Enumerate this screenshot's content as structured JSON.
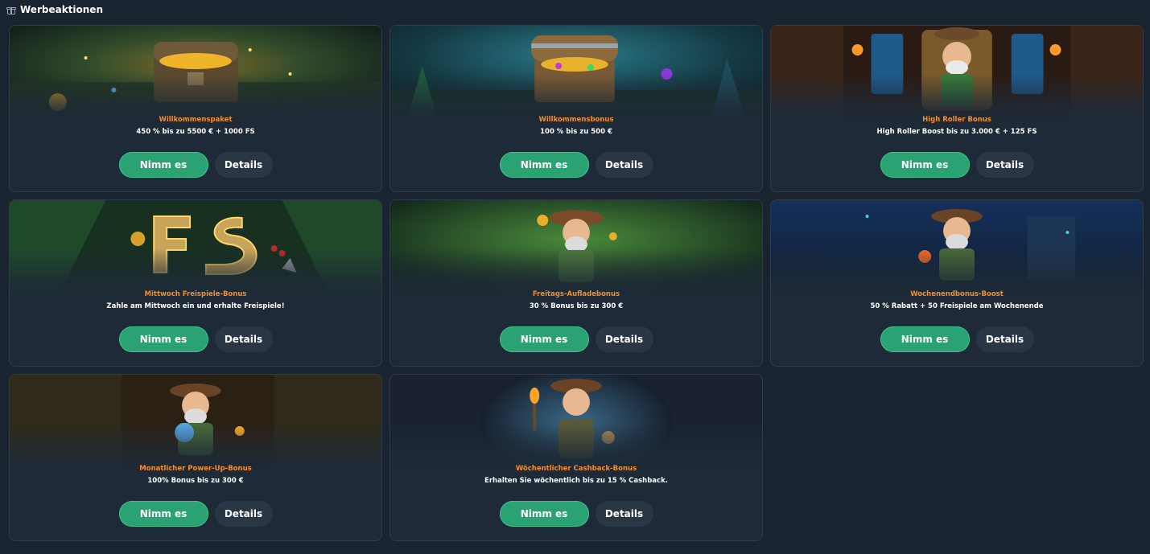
{
  "header": {
    "title": "Werbeaktionen",
    "icon": "gift-icon"
  },
  "colors": {
    "accent_orange": "#f28f2c",
    "take_button": "#2aa273",
    "details_button": "#2a3644",
    "card_bg": "#1e2a37",
    "page_bg": "#1a2430"
  },
  "buttons": {
    "take_label": "Nimm es",
    "details_label": "Details"
  },
  "cards": [
    {
      "title": "Willkommenspaket",
      "desc": "450 % bis zu 5500 € + 1000 FS",
      "art": "treasure-chest"
    },
    {
      "title": "Willkommensbonus",
      "desc": "100 % bis zu 500 €",
      "art": "treasure-chest"
    },
    {
      "title": "High Roller Bonus",
      "desc": "High Roller Boost bis zu 3.000 € + 125 FS",
      "art": "explorer-throne"
    },
    {
      "title": "Mittwoch Freispiele-Bonus",
      "desc": "Zahle am Mittwoch ein und erhalte Freispiele!",
      "art": "fs-letters"
    },
    {
      "title": "Freitags-Aufladebonus",
      "desc": "30 % Bonus bis zu 300 €",
      "art": "explorer-jungle"
    },
    {
      "title": "Wochenendbonus-Boost",
      "desc": "50 % Rabatt + 50 Freispiele am Wochenende",
      "art": "explorer-night"
    },
    {
      "title": "Monatlicher Power-Up-Bonus",
      "desc": "100% Bonus bis zu 300 €",
      "art": "explorer-gem"
    },
    {
      "title": "Wöchentlicher Cashback-Bonus",
      "desc": "Erhalten Sie wöchentlich bis zu 15 % Cashback.",
      "art": "explorer-torch"
    }
  ]
}
